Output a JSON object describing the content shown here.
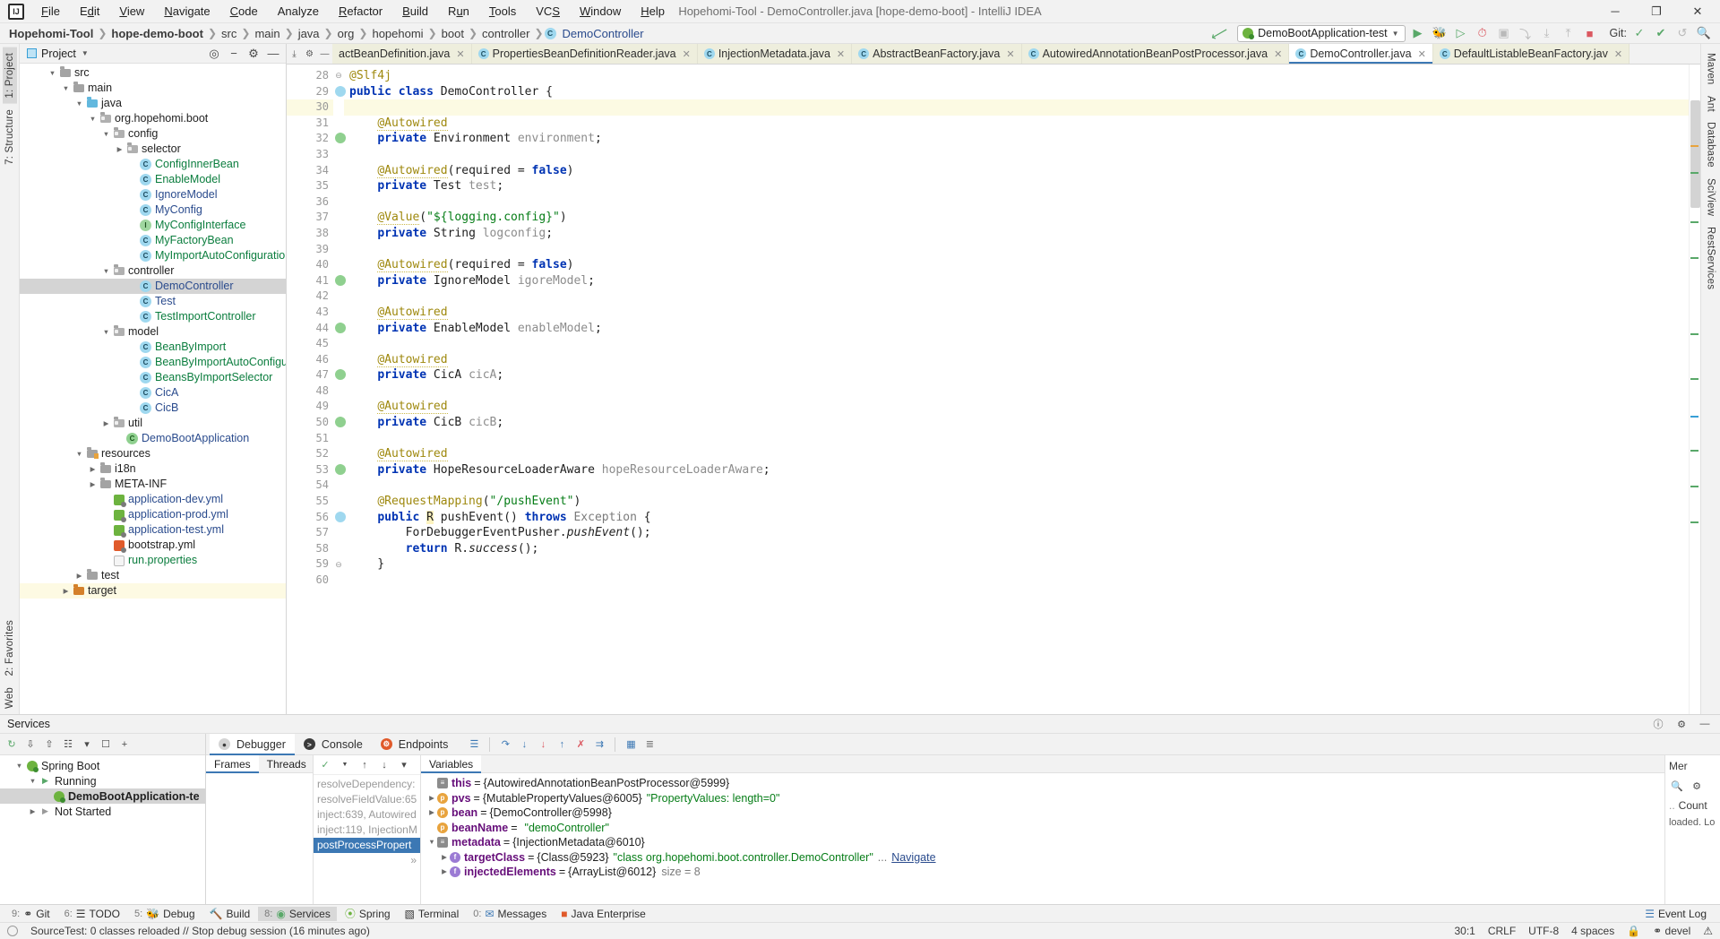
{
  "window": {
    "title": "Hopehomi-Tool - DemoController.java [hope-demo-boot] - IntelliJ IDEA",
    "minimize": "─",
    "maximize": "❐",
    "close": "✕",
    "logo": "IJ"
  },
  "menu": [
    "File",
    "Edit",
    "View",
    "Navigate",
    "Code",
    "Analyze",
    "Refactor",
    "Build",
    "Run",
    "Tools",
    "VCS",
    "Window",
    "Help"
  ],
  "breadcrumb": [
    {
      "label": "Hopehomi-Tool",
      "bold": true
    },
    {
      "label": "hope-demo-boot",
      "bold": true
    },
    {
      "label": "src",
      "bold": false
    },
    {
      "label": "main",
      "bold": false
    },
    {
      "label": "java",
      "bold": false
    },
    {
      "label": "org",
      "bold": false
    },
    {
      "label": "hopehomi",
      "bold": false
    },
    {
      "label": "boot",
      "bold": false
    },
    {
      "label": "controller",
      "bold": false
    },
    {
      "label": "DemoController",
      "bold": false,
      "icon": "class-icon",
      "file": true
    }
  ],
  "toolbar": {
    "run_config": "DemoBootApplication-test",
    "run_config_icon": "spring-boot-icon",
    "vcs_label": "Git:",
    "dropdown_caret": "▼"
  },
  "project_panel": {
    "title": "Project",
    "caret": "▼",
    "tree": [
      {
        "depth": 2,
        "twisty": "▼",
        "icon": "folder",
        "label": "src",
        "color": "dark"
      },
      {
        "depth": 3,
        "twisty": "▼",
        "icon": "folder",
        "label": "main",
        "color": "dark"
      },
      {
        "depth": 4,
        "twisty": "▼",
        "icon": "folder-blue",
        "label": "java",
        "color": "dark"
      },
      {
        "depth": 5,
        "twisty": "▼",
        "icon": "package",
        "label": "org.hopehomi.boot",
        "color": "dark"
      },
      {
        "depth": 6,
        "twisty": "▼",
        "icon": "package",
        "label": "config",
        "color": "dark"
      },
      {
        "depth": 7,
        "twisty": "▶",
        "icon": "package",
        "label": "selector",
        "color": "dark"
      },
      {
        "depth": 8,
        "twisty": "",
        "icon": "class",
        "label": "ConfigInnerBean",
        "color": "green"
      },
      {
        "depth": 8,
        "twisty": "",
        "icon": "class",
        "label": "EnableModel",
        "color": "green"
      },
      {
        "depth": 8,
        "twisty": "",
        "icon": "class",
        "label": "IgnoreModel",
        "color": "blue"
      },
      {
        "depth": 8,
        "twisty": "",
        "icon": "class",
        "label": "MyConfig",
        "color": "blue"
      },
      {
        "depth": 8,
        "twisty": "",
        "icon": "interface",
        "label": "MyConfigInterface",
        "color": "green"
      },
      {
        "depth": 8,
        "twisty": "",
        "icon": "class",
        "label": "MyFactoryBean",
        "color": "green"
      },
      {
        "depth": 8,
        "twisty": "",
        "icon": "class",
        "label": "MyImportAutoConfiguration",
        "color": "green"
      },
      {
        "depth": 6,
        "twisty": "▼",
        "icon": "package",
        "label": "controller",
        "color": "dark"
      },
      {
        "depth": 8,
        "twisty": "",
        "icon": "class",
        "label": "DemoController",
        "color": "blue",
        "selected": true
      },
      {
        "depth": 8,
        "twisty": "",
        "icon": "class",
        "label": "Test",
        "color": "blue"
      },
      {
        "depth": 8,
        "twisty": "",
        "icon": "class",
        "label": "TestImportController",
        "color": "green"
      },
      {
        "depth": 6,
        "twisty": "▼",
        "icon": "package",
        "label": "model",
        "color": "dark"
      },
      {
        "depth": 8,
        "twisty": "",
        "icon": "class",
        "label": "BeanByImport",
        "color": "green"
      },
      {
        "depth": 8,
        "twisty": "",
        "icon": "class",
        "label": "BeanByImportAutoConfiguration",
        "color": "green"
      },
      {
        "depth": 8,
        "twisty": "",
        "icon": "class",
        "label": "BeansByImportSelector",
        "color": "green"
      },
      {
        "depth": 8,
        "twisty": "",
        "icon": "class",
        "label": "CicA",
        "color": "blue"
      },
      {
        "depth": 8,
        "twisty": "",
        "icon": "class",
        "label": "CicB",
        "color": "blue"
      },
      {
        "depth": 6,
        "twisty": "▶",
        "icon": "package",
        "label": "util",
        "color": "dark"
      },
      {
        "depth": 7,
        "twisty": "",
        "icon": "spring-class",
        "label": "DemoBootApplication",
        "color": "blue"
      },
      {
        "depth": 4,
        "twisty": "▼",
        "icon": "folder-res",
        "label": "resources",
        "color": "dark"
      },
      {
        "depth": 5,
        "twisty": "▶",
        "icon": "folder",
        "label": "i18n",
        "color": "dark"
      },
      {
        "depth": 5,
        "twisty": "▶",
        "icon": "folder",
        "label": "META-INF",
        "color": "dark"
      },
      {
        "depth": 6,
        "twisty": "",
        "icon": "yml-spring",
        "label": "application-dev.yml",
        "color": "blue"
      },
      {
        "depth": 6,
        "twisty": "",
        "icon": "yml-spring",
        "label": "application-prod.yml",
        "color": "blue"
      },
      {
        "depth": 6,
        "twisty": "",
        "icon": "yml-spring",
        "label": "application-test.yml",
        "color": "blue"
      },
      {
        "depth": 6,
        "twisty": "",
        "icon": "yml-plain",
        "label": "bootstrap.yml",
        "color": "dark"
      },
      {
        "depth": 6,
        "twisty": "",
        "icon": "properties",
        "label": "run.properties",
        "color": "green"
      },
      {
        "depth": 4,
        "twisty": "▶",
        "icon": "folder",
        "label": "test",
        "color": "dark"
      },
      {
        "depth": 3,
        "twisty": "▶",
        "icon": "folder-orange",
        "label": "target",
        "color": "dark",
        "highlight": true
      }
    ]
  },
  "left_strip": [
    {
      "label": "1: Project",
      "selected": true
    },
    {
      "label": "7: Structure",
      "selected": false
    }
  ],
  "left_strip_bottom": [
    {
      "label": "2: Favorites"
    },
    {
      "label": "Web"
    }
  ],
  "right_strip": [
    {
      "label": "Maven"
    },
    {
      "label": "Ant"
    },
    {
      "label": "Database"
    },
    {
      "label": "SciView"
    },
    {
      "label": "RestServices"
    }
  ],
  "editor_tabs": [
    {
      "label": "actBeanDefinition.java",
      "icon": "class-icon",
      "active": false,
      "truncated": true
    },
    {
      "label": "PropertiesBeanDefinitionReader.java",
      "icon": "class-icon",
      "active": false
    },
    {
      "label": "InjectionMetadata.java",
      "icon": "class-icon",
      "active": false
    },
    {
      "label": "AbstractBeanFactory.java",
      "icon": "class-icon",
      "active": false
    },
    {
      "label": "AutowiredAnnotationBeanPostProcessor.java",
      "icon": "class-icon",
      "active": false
    },
    {
      "label": "DemoController.java",
      "icon": "class-icon",
      "active": true
    },
    {
      "label": "DefaultListableBeanFactory.jav",
      "icon": "class-icon",
      "active": false
    }
  ],
  "editor": {
    "first_line": 28,
    "lines": [
      {
        "n": 28,
        "fold": "⊖",
        "html": "<span class='ann'>@Slf4j</span>"
      },
      {
        "n": 29,
        "gmark": "bean",
        "html": "<span class='kw'>public</span> <span class='kw'>class</span> DemoController {"
      },
      {
        "n": 30,
        "hl": true,
        "html": ""
      },
      {
        "n": 31,
        "html": "    <span class='ann-u'>@Autowired</span>"
      },
      {
        "n": 32,
        "gmark": "bean2",
        "html": "    <span class='kw'>private</span> Environment <span class='fld'>environment</span>;"
      },
      {
        "n": 33,
        "html": ""
      },
      {
        "n": 34,
        "html": "    <span class='ann-u'>@Autowired</span>(required = <span class='kw'>false</span>)"
      },
      {
        "n": 35,
        "html": "    <span class='kw'>private</span> Test <span class='fld'>test</span>;"
      },
      {
        "n": 36,
        "html": ""
      },
      {
        "n": 37,
        "html": "    <span class='ann-u'>@Value</span>(<span class='str'>\"${logging.config}\"</span>)"
      },
      {
        "n": 38,
        "html": "    <span class='kw'>private</span> String <span class='fld'>logconfig</span>;"
      },
      {
        "n": 39,
        "html": ""
      },
      {
        "n": 40,
        "html": "    <span class='ann-u'>@Autowired</span>(required = <span class='kw'>false</span>)"
      },
      {
        "n": 41,
        "gmark": "bean2",
        "html": "    <span class='kw'>private</span> IgnoreModel <span class='fld'>igoreModel</span>;"
      },
      {
        "n": 42,
        "html": ""
      },
      {
        "n": 43,
        "html": "    <span class='ann-u'>@Autowired</span>"
      },
      {
        "n": 44,
        "gmark": "bean2",
        "html": "    <span class='kw'>private</span> EnableModel <span class='fld'>enableModel</span>;"
      },
      {
        "n": 45,
        "html": ""
      },
      {
        "n": 46,
        "html": "    <span class='ann-u'>@Autowired</span>"
      },
      {
        "n": 47,
        "gmark": "bean2",
        "html": "    <span class='kw'>private</span> CicA <span class='fld'>cicA</span>;"
      },
      {
        "n": 48,
        "html": ""
      },
      {
        "n": 49,
        "html": "    <span class='ann-u'>@Autowired</span>"
      },
      {
        "n": 50,
        "gmark": "bean2",
        "html": "    <span class='kw'>private</span> CicB <span class='fld'>cicB</span>;"
      },
      {
        "n": 51,
        "html": ""
      },
      {
        "n": 52,
        "html": "    <span class='ann-u'>@Autowired</span>"
      },
      {
        "n": 53,
        "gmark": "bean2",
        "html": "    <span class='kw'>private</span> HopeResourceLoaderAware <span class='fld'>hopeResourceLoaderAware</span>;"
      },
      {
        "n": 54,
        "html": ""
      },
      {
        "n": 55,
        "html": "    <span class='ann'>@RequestMapping</span>(<span class='str'>\"/pushEvent\"</span>)"
      },
      {
        "n": 56,
        "gmark": "bean",
        "fold": "⊖",
        "html": "    <span class='kw'>public</span> <span class='cls-hl'>R</span> pushEvent() <span class='kw'>throws</span> <span class='gray'>Exception</span> {"
      },
      {
        "n": 57,
        "html": "        ForDebuggerEventPusher.<span class='ital'>pushEvent</span>();"
      },
      {
        "n": 58,
        "html": "        <span class='kw'>return</span> R.<span class='ital'>success</span>();"
      },
      {
        "n": 59,
        "fold": "⊖",
        "html": "    }"
      },
      {
        "n": 60,
        "html": ""
      }
    ]
  },
  "services": {
    "title": "Services",
    "tree": [
      {
        "depth": 1,
        "twisty": "▼",
        "icon": "spring",
        "label": "Spring Boot"
      },
      {
        "depth": 2,
        "twisty": "▼",
        "icon": "run",
        "label": "Running"
      },
      {
        "depth": 3,
        "twisty": "",
        "icon": "app",
        "label": "DemoBootApplication-te",
        "selected": true
      },
      {
        "depth": 2,
        "twisty": "▶",
        "icon": "stop",
        "label": "Not Started"
      }
    ],
    "debug_tabs": [
      {
        "label": "Debugger",
        "icon": "debugger-icon",
        "active": true
      },
      {
        "label": "Console",
        "icon": "console-icon",
        "active": false
      },
      {
        "label": "Endpoints",
        "icon": "endpoints-icon",
        "active": false
      }
    ],
    "sub_tabs": [
      {
        "label": "Frames",
        "active": true
      },
      {
        "label": "Threads",
        "active": false
      },
      {
        "label": "Variables",
        "active": true
      }
    ],
    "frames": [
      {
        "label": "resolveDependency:",
        "selected": false
      },
      {
        "label": "resolveFieldValue:65",
        "selected": false
      },
      {
        "label": "inject:639, Autowired",
        "selected": false
      },
      {
        "label": "inject:119, InjectionM",
        "selected": false
      },
      {
        "label": "postProcessPropert",
        "selected": true
      }
    ],
    "variables": [
      {
        "depth": 0,
        "twisty": "",
        "badge": "m",
        "name": "this",
        "eq": "=",
        "value": "{AutowiredAnnotationBeanPostProcessor@5999}"
      },
      {
        "depth": 0,
        "twisty": "▶",
        "badge": "p",
        "name": "pvs",
        "eq": "=",
        "value": "{MutablePropertyValues@6005}",
        "str": "\"PropertyValues: length=0\""
      },
      {
        "depth": 0,
        "twisty": "▶",
        "badge": "p",
        "name": "bean",
        "eq": "=",
        "value": "{DemoController@5998}"
      },
      {
        "depth": 0,
        "twisty": "",
        "badge": "p",
        "name": "beanName",
        "eq": "=",
        "str": "\"demoController\""
      },
      {
        "depth": 0,
        "twisty": "▼",
        "badge": "m",
        "name": "metadata",
        "eq": "=",
        "value": "{InjectionMetadata@6010}"
      },
      {
        "depth": 1,
        "twisty": "▶",
        "badge": "f",
        "name": "targetClass",
        "eq": "=",
        "value": "{Class@5923}",
        "str": "\"class org.hopehomi.boot.controller.DemoController\"",
        "ellipsis": "...",
        "link": "Navigate"
      },
      {
        "depth": 1,
        "twisty": "▶",
        "badge": "f",
        "name": "injectedElements",
        "eq": "=",
        "value": "{ArrayList@6012}",
        "size": "size = 8"
      }
    ],
    "far_right": {
      "mer": "Mer",
      "count": "Count",
      "loaded": "loaded. Lo"
    }
  },
  "toolwindow_bar": [
    {
      "label": "Git",
      "num": "9:",
      "icon": "git-icon"
    },
    {
      "label": "TODO",
      "num": "6:",
      "icon": "todo-icon"
    },
    {
      "label": "Debug",
      "num": "5:",
      "icon": "debug-icon"
    },
    {
      "label": "Build",
      "num": "",
      "icon": "build-icon"
    },
    {
      "label": "Services",
      "num": "8:",
      "icon": "services-icon",
      "selected": true
    },
    {
      "label": "Spring",
      "num": "",
      "icon": "spring-icon"
    },
    {
      "label": "Terminal",
      "num": "",
      "icon": "terminal-icon"
    },
    {
      "label": "Messages",
      "num": "0:",
      "icon": "messages-icon"
    },
    {
      "label": "Java Enterprise",
      "num": "",
      "icon": "java-ee-icon"
    }
  ],
  "toolwindow_right": [
    {
      "label": "Event Log",
      "icon": "event-log-icon"
    }
  ],
  "status": {
    "message": "SourceTest: 0 classes reloaded // Stop debug session (16 minutes ago)",
    "caret": "30:1",
    "line_sep": "CRLF",
    "encoding": "UTF-8",
    "indent": "4 spaces",
    "branch": "devel",
    "lock_icon": "lock-icon"
  }
}
